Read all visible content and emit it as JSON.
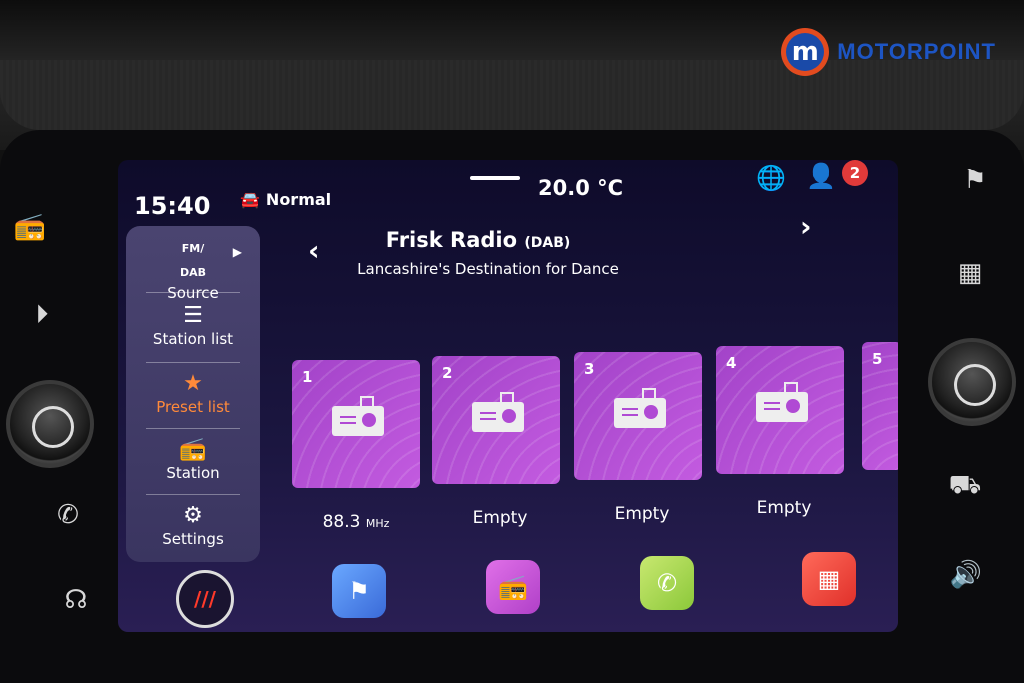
{
  "brand": {
    "logo_letter": "m",
    "name": "MOTORPOINT"
  },
  "status_bar": {
    "time": "15:40",
    "drive_mode": "Normal",
    "temperature": "20.0 °C",
    "notification_count": "2"
  },
  "sidebar": {
    "items": [
      {
        "top": "FM/",
        "bottom": "DAB",
        "label": "Source"
      },
      {
        "label": "Station list"
      },
      {
        "label": "Preset list",
        "active": true
      },
      {
        "label": "Station"
      },
      {
        "label": "Settings"
      }
    ]
  },
  "now_playing": {
    "station": "Frisk Radio",
    "band": "(DAB)",
    "description": "Lancashire's Destination for Dance"
  },
  "presets": [
    {
      "number": "1",
      "label": "88.3",
      "unit": "MHz"
    },
    {
      "number": "2",
      "label": "Empty"
    },
    {
      "number": "3",
      "label": "Empty"
    },
    {
      "number": "4",
      "label": "Empty"
    },
    {
      "number": "5",
      "label": ""
    }
  ],
  "dock": {
    "home_label": "///"
  },
  "colors": {
    "accent": "#ff8a3a",
    "preset_tile": "#b550d8",
    "notification": "#e03a3a"
  }
}
